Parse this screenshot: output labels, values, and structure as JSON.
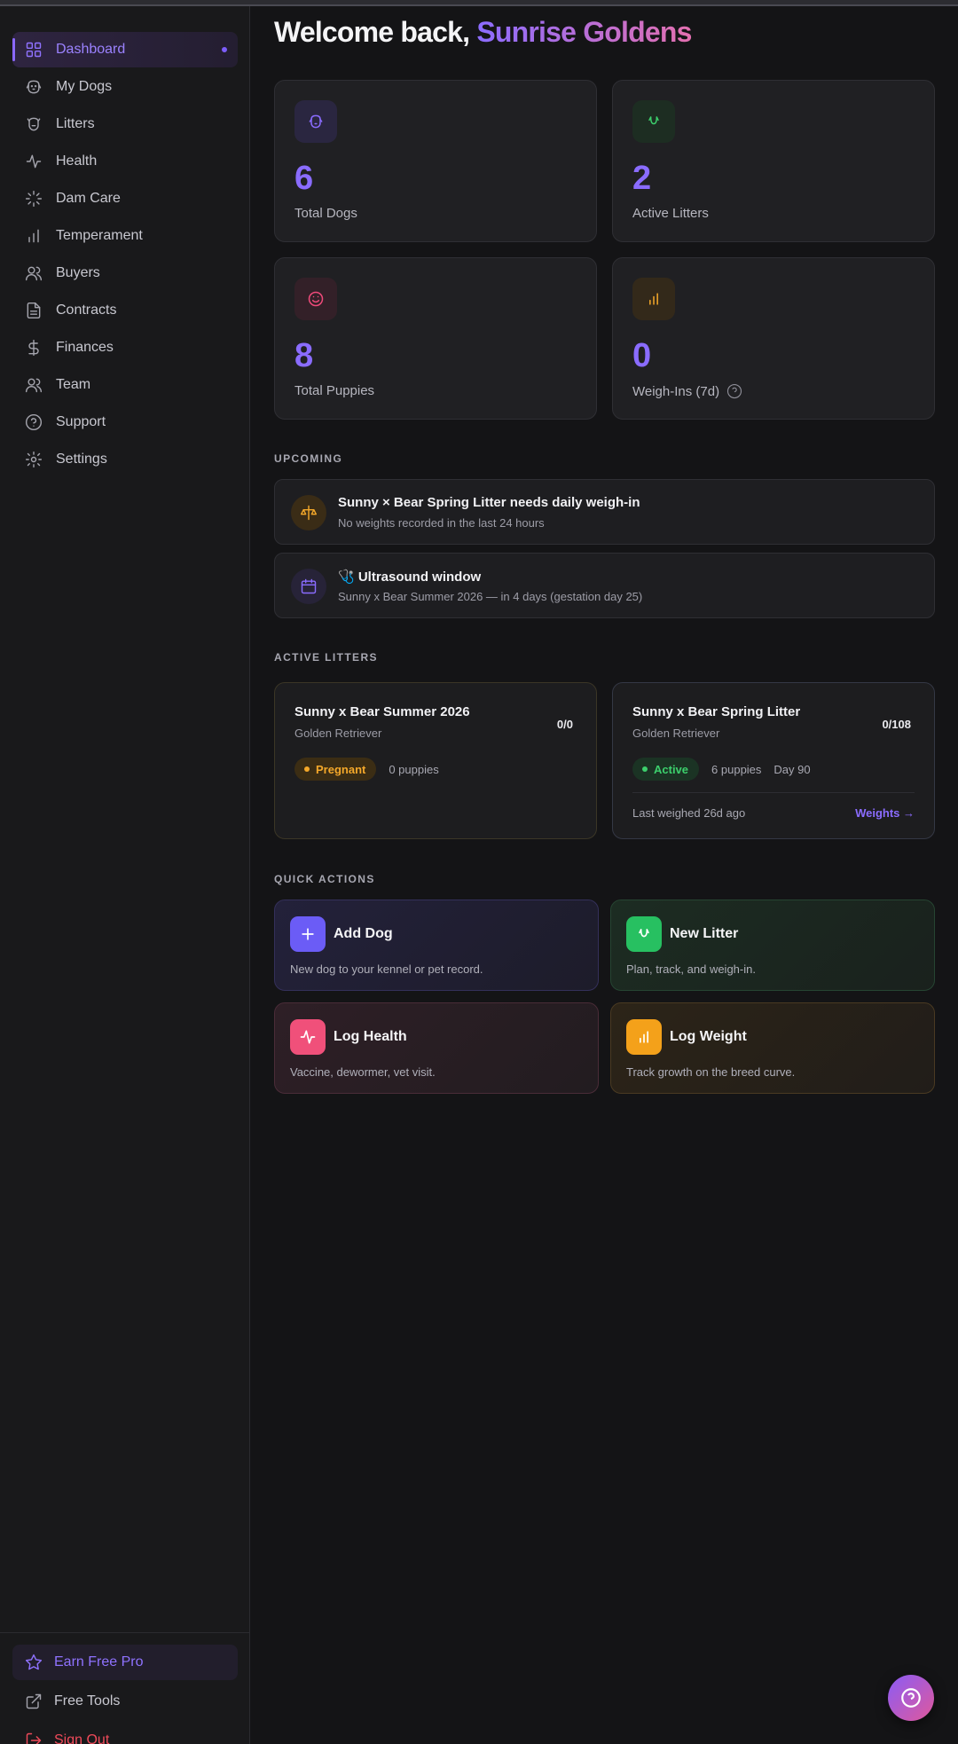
{
  "sidebar": {
    "items": [
      {
        "label": "Dashboard",
        "icon": "grid-icon",
        "active": true
      },
      {
        "label": "My Dogs",
        "icon": "dog-icon"
      },
      {
        "label": "Litters",
        "icon": "litter-icon"
      },
      {
        "label": "Health",
        "icon": "activity-icon"
      },
      {
        "label": "Dam Care",
        "icon": "loader-icon"
      },
      {
        "label": "Temperament",
        "icon": "bar-chart-icon"
      },
      {
        "label": "Buyers",
        "icon": "users-icon"
      },
      {
        "label": "Contracts",
        "icon": "file-icon"
      },
      {
        "label": "Finances",
        "icon": "dollar-icon"
      },
      {
        "label": "Team",
        "icon": "team-icon"
      },
      {
        "label": "Support",
        "icon": "help-circle-icon"
      },
      {
        "label": "Settings",
        "icon": "gear-icon"
      }
    ],
    "earn_label": "Earn Free Pro",
    "free_tools_label": "Free Tools",
    "sign_out_label": "Sign Out"
  },
  "header": {
    "welcome_prefix": "Welcome back, ",
    "kennel_name": "Sunrise Goldens"
  },
  "stats": [
    {
      "value": "6",
      "label": "Total Dogs",
      "icon": "dog-face-icon",
      "color": "#8a6cff"
    },
    {
      "value": "2",
      "label": "Active Litters",
      "icon": "paw-icon",
      "color": "#3ccf6c"
    },
    {
      "value": "8",
      "label": "Total Puppies",
      "icon": "smile-icon",
      "color": "#ef4a7a"
    },
    {
      "value": "0",
      "label": "Weigh-Ins (7d)",
      "icon": "bar-chart-icon",
      "color": "#f4a82a"
    }
  ],
  "upcoming": {
    "heading": "UPCOMING",
    "items": [
      {
        "title": "Sunny × Bear Spring Litter needs daily weigh-in",
        "subtitle": "No weights recorded in the last 24 hours",
        "icon": "scale-icon"
      },
      {
        "title": "🩺 Ultrasound window",
        "subtitle": "Sunny x Bear Summer 2026 — in 4 days (gestation day 25)",
        "icon": "calendar-icon"
      }
    ]
  },
  "active_litters": {
    "heading": "ACTIVE LITTERS",
    "items": [
      {
        "name": "Sunny x Bear Summer 2026",
        "breed": "Golden Retriever",
        "count": "0/0",
        "status": "Pregnant",
        "puppies": "0 puppies"
      },
      {
        "name": "Sunny x Bear Spring Litter",
        "breed": "Golden Retriever",
        "count": "0/108",
        "status": "Active",
        "puppies": "6 puppies",
        "day": "Day 90",
        "last_weighed": "Last weighed 26d ago",
        "link": "Weights →"
      }
    ]
  },
  "quick_actions": {
    "heading": "QUICK ACTIONS",
    "items": [
      {
        "title": "Add Dog",
        "desc": "New dog to your kennel or pet record.",
        "icon": "plus-icon",
        "color": "#6b5cf6"
      },
      {
        "title": "New Litter",
        "desc": "Plan, track, and weigh-in.",
        "icon": "paw-icon",
        "color": "#27c061"
      },
      {
        "title": "Log Health",
        "desc": "Vaccine, dewormer, vet visit.",
        "icon": "activity-icon",
        "color": "#f0507a"
      },
      {
        "title": "Log Weight",
        "desc": "Track growth on the breed curve.",
        "icon": "bar-chart-icon",
        "color": "#f4a11a"
      }
    ]
  }
}
